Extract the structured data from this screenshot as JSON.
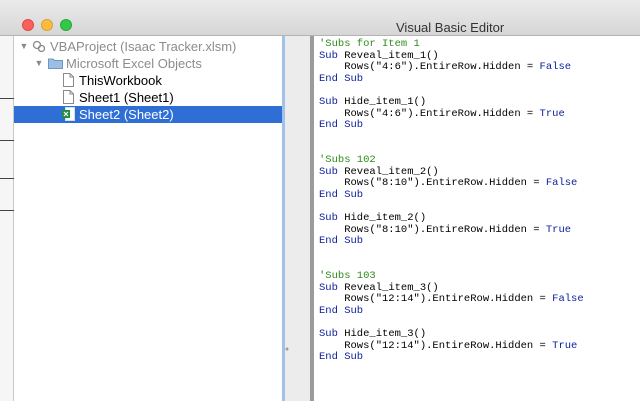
{
  "window": {
    "title": "Visual Basic Editor",
    "controls": [
      "close-icon",
      "minimize-icon",
      "zoom-icon"
    ]
  },
  "project_tree": {
    "project": "VBAProject (Isaac Tracker.xlsm)",
    "folder": "Microsoft Excel Objects",
    "items": [
      {
        "label": "ThisWorkbook",
        "icon": "document-icon",
        "selected": false
      },
      {
        "label": "Sheet1 (Sheet1)",
        "icon": "document-icon",
        "selected": false
      },
      {
        "label": "Sheet2 (Sheet2)",
        "icon": "excel-sheet-icon",
        "selected": true
      }
    ]
  },
  "colors": {
    "selection": "#2f6fd5",
    "comment": "#2e8b1c",
    "keyword": "#0b1d9c"
  },
  "code_editor": {
    "lines": [
      {
        "line": 1,
        "kind": "comment",
        "text": "'Subs for Item 1"
      },
      {
        "line": 2,
        "kind": "sub",
        "kw": "Sub",
        "name": " Reveal_item_1()"
      },
      {
        "line": 3,
        "kind": "stmt",
        "text": "    Rows(\"4:6\").EntireRow.Hidden = ",
        "kw": "False"
      },
      {
        "line": 4,
        "kind": "end",
        "text": "End Sub"
      },
      {
        "line": 6,
        "kind": "sub",
        "kw": "Sub",
        "name": " Hide_item_1()"
      },
      {
        "line": 7,
        "kind": "stmt",
        "text": "    Rows(\"4:6\").EntireRow.Hidden = ",
        "kw": "True"
      },
      {
        "line": 8,
        "kind": "end",
        "text": "End Sub"
      },
      {
        "line": 11,
        "kind": "comment",
        "text": "'Subs 102"
      },
      {
        "line": 12,
        "kind": "sub",
        "kw": "Sub",
        "name": " Reveal_item_2()"
      },
      {
        "line": 13,
        "kind": "stmt",
        "text": "    Rows(\"8:10\").EntireRow.Hidden = ",
        "kw": "False"
      },
      {
        "line": 14,
        "kind": "end",
        "text": "End Sub"
      },
      {
        "line": 16,
        "kind": "sub",
        "kw": "Sub",
        "name": " Hide_item_2()"
      },
      {
        "line": 17,
        "kind": "stmt",
        "text": "    Rows(\"8:10\").EntireRow.Hidden = ",
        "kw": "True"
      },
      {
        "line": 18,
        "kind": "end",
        "text": "End Sub"
      },
      {
        "line": 21,
        "kind": "comment",
        "text": "'Subs 103"
      },
      {
        "line": 22,
        "kind": "sub",
        "kw": "Sub",
        "name": " Reveal_item_3()"
      },
      {
        "line": 23,
        "kind": "stmt",
        "text": "    Rows(\"12:14\").EntireRow.Hidden = ",
        "kw": "False"
      },
      {
        "line": 24,
        "kind": "end",
        "text": "End Sub"
      },
      {
        "line": 26,
        "kind": "sub",
        "kw": "Sub",
        "name": " Hide_item_3()"
      },
      {
        "line": 27,
        "kind": "stmt",
        "text": "    Rows(\"12:14\").EntireRow.Hidden = ",
        "kw": "True"
      },
      {
        "line": 28,
        "kind": "end",
        "text": "End Sub"
      }
    ]
  }
}
